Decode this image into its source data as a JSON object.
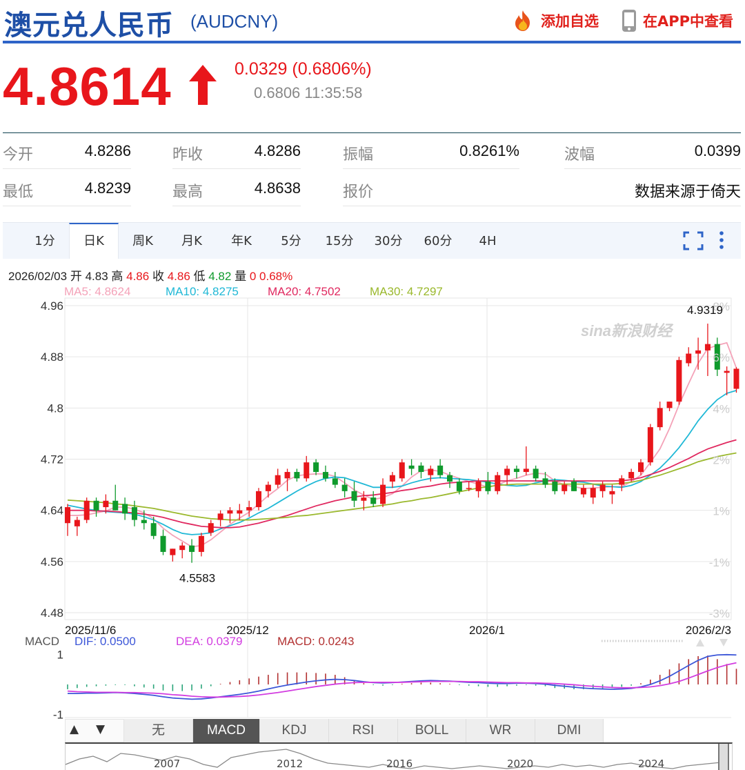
{
  "header": {
    "title": "澳元兑人民币",
    "code": "(AUDCNY)",
    "add_watch": "添加自选",
    "view_app": "在APP中查看"
  },
  "quote": {
    "price": "4.8614",
    "change": "0.0329 (0.6806%)",
    "sub": "0.6806 11:35:58"
  },
  "stats": [
    {
      "label": "今开",
      "value": "4.8286"
    },
    {
      "label": "昨收",
      "value": "4.8286"
    },
    {
      "label": "振幅",
      "value": "0.8261%"
    },
    {
      "label": "波幅",
      "value": "0.0399"
    },
    {
      "label": "最低",
      "value": "4.8239"
    },
    {
      "label": "最高",
      "value": "4.8638"
    },
    {
      "label": "报价",
      "value": "数据来源于倚天"
    }
  ],
  "tabs": [
    "1分",
    "日K",
    "周K",
    "月K",
    "年K",
    "5分",
    "15分",
    "30分",
    "60分",
    "4H"
  ],
  "active_tab": "日K",
  "ohlc": {
    "date": "2026/02/03",
    "open_label": "开",
    "open": "4.83",
    "high_label": "高",
    "high": "4.86",
    "close_label": "收",
    "close": "4.86",
    "low_label": "低",
    "low": "4.82",
    "vol_label": "量",
    "vol": "0",
    "pct": "0.68%"
  },
  "ma": {
    "ma5": "MA5: 4.8624",
    "ma10": "MA10: 4.8275",
    "ma20": "MA20: 4.7502",
    "ma30": "MA30: 4.7297"
  },
  "watermark": "sina新浪财经",
  "colors": {
    "up": "#e8161b",
    "down": "#0f9a2c",
    "accent": "#2e64c8",
    "ma5": "#f4a2b8",
    "ma10": "#1fb8d6",
    "ma20": "#e0285f",
    "ma30": "#9ab82c"
  },
  "chart_data": {
    "type": "candlestick",
    "title": "",
    "ylim": [
      4.48,
      4.96
    ],
    "yticks": [
      "4.96",
      "4.88",
      "4.8",
      "4.72",
      "4.64",
      "4.56",
      "4.48"
    ],
    "pct_ticks": [
      "8%",
      "6%",
      "4%",
      "2%",
      "1%",
      "-1%",
      "-3%"
    ],
    "x_labels": [
      "2025/11/6",
      "2025/12",
      "2026/1",
      "2026/2/3"
    ],
    "max_label": "4.9319",
    "min_label": "4.5583",
    "candles": [
      {
        "o": 4.62,
        "h": 4.65,
        "l": 4.6,
        "c": 4.645
      },
      {
        "o": 4.615,
        "h": 4.63,
        "l": 4.6,
        "c": 4.625
      },
      {
        "o": 4.625,
        "h": 4.66,
        "l": 4.62,
        "c": 4.655
      },
      {
        "o": 4.655,
        "h": 4.66,
        "l": 4.63,
        "c": 4.64
      },
      {
        "o": 4.645,
        "h": 4.665,
        "l": 4.635,
        "c": 4.655
      },
      {
        "o": 4.655,
        "h": 4.68,
        "l": 4.64,
        "c": 4.64
      },
      {
        "o": 4.65,
        "h": 4.66,
        "l": 4.625,
        "c": 4.635
      },
      {
        "o": 4.645,
        "h": 4.655,
        "l": 4.615,
        "c": 4.625
      },
      {
        "o": 4.625,
        "h": 4.64,
        "l": 4.61,
        "c": 4.62
      },
      {
        "o": 4.62,
        "h": 4.63,
        "l": 4.595,
        "c": 4.6
      },
      {
        "o": 4.6,
        "h": 4.61,
        "l": 4.57,
        "c": 4.575
      },
      {
        "o": 4.57,
        "h": 4.58,
        "l": 4.56,
        "c": 4.58
      },
      {
        "o": 4.578,
        "h": 4.59,
        "l": 4.565,
        "c": 4.585
      },
      {
        "o": 4.585,
        "h": 4.595,
        "l": 4.558,
        "c": 4.575
      },
      {
        "o": 4.575,
        "h": 4.605,
        "l": 4.568,
        "c": 4.6
      },
      {
        "o": 4.605,
        "h": 4.625,
        "l": 4.6,
        "c": 4.62
      },
      {
        "o": 4.625,
        "h": 4.64,
        "l": 4.615,
        "c": 4.635
      },
      {
        "o": 4.635,
        "h": 4.645,
        "l": 4.62,
        "c": 4.64
      },
      {
        "o": 4.635,
        "h": 4.65,
        "l": 4.625,
        "c": 4.64
      },
      {
        "o": 4.64,
        "h": 4.655,
        "l": 4.63,
        "c": 4.645
      },
      {
        "o": 4.645,
        "h": 4.675,
        "l": 4.64,
        "c": 4.67
      },
      {
        "o": 4.67,
        "h": 4.685,
        "l": 4.66,
        "c": 4.68
      },
      {
        "o": 4.68,
        "h": 4.705,
        "l": 4.675,
        "c": 4.695
      },
      {
        "o": 4.69,
        "h": 4.705,
        "l": 4.67,
        "c": 4.7
      },
      {
        "o": 4.7,
        "h": 4.705,
        "l": 4.685,
        "c": 4.69
      },
      {
        "o": 4.69,
        "h": 4.725,
        "l": 4.685,
        "c": 4.715
      },
      {
        "o": 4.715,
        "h": 4.72,
        "l": 4.695,
        "c": 4.7
      },
      {
        "o": 4.7,
        "h": 4.71,
        "l": 4.685,
        "c": 4.69
      },
      {
        "o": 4.69,
        "h": 4.7,
        "l": 4.675,
        "c": 4.68
      },
      {
        "o": 4.68,
        "h": 4.69,
        "l": 4.66,
        "c": 4.67
      },
      {
        "o": 4.67,
        "h": 4.685,
        "l": 4.645,
        "c": 4.655
      },
      {
        "o": 4.655,
        "h": 4.67,
        "l": 4.64,
        "c": 4.66
      },
      {
        "o": 4.66,
        "h": 4.67,
        "l": 4.645,
        "c": 4.65
      },
      {
        "o": 4.65,
        "h": 4.69,
        "l": 4.645,
        "c": 4.68
      },
      {
        "o": 4.685,
        "h": 4.7,
        "l": 4.675,
        "c": 4.695
      },
      {
        "o": 4.69,
        "h": 4.72,
        "l": 4.685,
        "c": 4.715
      },
      {
        "o": 4.71,
        "h": 4.72,
        "l": 4.695,
        "c": 4.705
      },
      {
        "o": 4.71,
        "h": 4.715,
        "l": 4.69,
        "c": 4.7
      },
      {
        "o": 4.695,
        "h": 4.71,
        "l": 4.685,
        "c": 4.705
      },
      {
        "o": 4.71,
        "h": 4.72,
        "l": 4.69,
        "c": 4.695
      },
      {
        "o": 4.695,
        "h": 4.7,
        "l": 4.675,
        "c": 4.685
      },
      {
        "o": 4.685,
        "h": 4.69,
        "l": 4.665,
        "c": 4.67
      },
      {
        "o": 4.675,
        "h": 4.685,
        "l": 4.67,
        "c": 4.675
      },
      {
        "o": 4.67,
        "h": 4.69,
        "l": 4.66,
        "c": 4.685
      },
      {
        "o": 4.685,
        "h": 4.7,
        "l": 4.665,
        "c": 4.67
      },
      {
        "o": 4.67,
        "h": 4.7,
        "l": 4.665,
        "c": 4.695
      },
      {
        "o": 4.695,
        "h": 4.71,
        "l": 4.68,
        "c": 4.705
      },
      {
        "o": 4.705,
        "h": 4.71,
        "l": 4.69,
        "c": 4.7
      },
      {
        "o": 4.7,
        "h": 4.74,
        "l": 4.695,
        "c": 4.705
      },
      {
        "o": 4.705,
        "h": 4.71,
        "l": 4.685,
        "c": 4.69
      },
      {
        "o": 4.69,
        "h": 4.7,
        "l": 4.675,
        "c": 4.68
      },
      {
        "o": 4.685,
        "h": 4.69,
        "l": 4.665,
        "c": 4.67
      },
      {
        "o": 4.67,
        "h": 4.685,
        "l": 4.665,
        "c": 4.68
      },
      {
        "o": 4.685,
        "h": 4.69,
        "l": 4.67,
        "c": 4.67
      },
      {
        "o": 4.665,
        "h": 4.68,
        "l": 4.66,
        "c": 4.675
      },
      {
        "o": 4.66,
        "h": 4.68,
        "l": 4.65,
        "c": 4.675
      },
      {
        "o": 4.67,
        "h": 4.685,
        "l": 4.66,
        "c": 4.68
      },
      {
        "o": 4.665,
        "h": 4.68,
        "l": 4.65,
        "c": 4.67
      },
      {
        "o": 4.68,
        "h": 4.695,
        "l": 4.67,
        "c": 4.69
      },
      {
        "o": 4.69,
        "h": 4.705,
        "l": 4.685,
        "c": 4.7
      },
      {
        "o": 4.7,
        "h": 4.72,
        "l": 4.695,
        "c": 4.715
      },
      {
        "o": 4.715,
        "h": 4.775,
        "l": 4.71,
        "c": 4.77
      },
      {
        "o": 4.77,
        "h": 4.81,
        "l": 4.765,
        "c": 4.8
      },
      {
        "o": 4.8,
        "h": 4.81,
        "l": 4.795,
        "c": 4.81
      },
      {
        "o": 4.81,
        "h": 4.88,
        "l": 4.805,
        "c": 4.875
      },
      {
        "o": 4.87,
        "h": 4.895,
        "l": 4.865,
        "c": 4.885
      },
      {
        "o": 4.885,
        "h": 4.91,
        "l": 4.86,
        "c": 4.89
      },
      {
        "o": 4.89,
        "h": 4.9319,
        "l": 4.85,
        "c": 4.9
      },
      {
        "o": 4.9,
        "h": 4.91,
        "l": 4.85,
        "c": 4.86
      },
      {
        "o": 4.855,
        "h": 4.865,
        "l": 4.82,
        "c": 4.858
      },
      {
        "o": 4.83,
        "h": 4.8638,
        "l": 4.8239,
        "c": 4.8614
      }
    ],
    "ma_series": [
      {
        "name": "MA5",
        "values": [
          4.632,
          4.632,
          4.633,
          4.636,
          4.639,
          4.645,
          4.645,
          4.642,
          4.636,
          4.627,
          4.612,
          4.601,
          4.592,
          4.583,
          4.585,
          4.594,
          4.606,
          4.618,
          4.628,
          4.637,
          4.65,
          4.663,
          4.674,
          4.687,
          4.694,
          4.696,
          4.697,
          4.697,
          4.693,
          4.683,
          4.672,
          4.664,
          4.657,
          4.66,
          4.666,
          4.678,
          4.692,
          4.702,
          4.703,
          4.701,
          4.695,
          4.69,
          4.685,
          4.681,
          4.676,
          4.68,
          4.686,
          4.69,
          4.695,
          4.698,
          4.697,
          4.686,
          4.68,
          4.677,
          4.674,
          4.675,
          4.676,
          4.677,
          4.677,
          4.685,
          4.695,
          4.715,
          4.736,
          4.768,
          4.805,
          4.838,
          4.87,
          4.893,
          4.898,
          4.902,
          4.8624
        ]
      },
      {
        "name": "MA10",
        "values": [
          4.648,
          4.645,
          4.642,
          4.64,
          4.638,
          4.637,
          4.636,
          4.634,
          4.63,
          4.625,
          4.618,
          4.61,
          4.604,
          4.602,
          4.603,
          4.605,
          4.611,
          4.616,
          4.621,
          4.628,
          4.636,
          4.643,
          4.652,
          4.661,
          4.67,
          4.678,
          4.685,
          4.69,
          4.692,
          4.691,
          4.686,
          4.681,
          4.676,
          4.676,
          4.676,
          4.678,
          4.683,
          4.687,
          4.69,
          4.691,
          4.69,
          4.689,
          4.688,
          4.686,
          4.684,
          4.681,
          4.679,
          4.678,
          4.679,
          4.683,
          4.686,
          4.688,
          4.687,
          4.685,
          4.684,
          4.681,
          4.678,
          4.677,
          4.676,
          4.679,
          4.685,
          4.695,
          4.706,
          4.721,
          4.738,
          4.758,
          4.78,
          4.798,
          4.813,
          4.823,
          4.8275
        ]
      },
      {
        "name": "MA20",
        "values": [
          4.64,
          4.64,
          4.64,
          4.639,
          4.639,
          4.638,
          4.637,
          4.636,
          4.634,
          4.632,
          4.629,
          4.625,
          4.621,
          4.618,
          4.615,
          4.614,
          4.613,
          4.613,
          4.614,
          4.617,
          4.62,
          4.624,
          4.628,
          4.632,
          4.637,
          4.642,
          4.647,
          4.651,
          4.655,
          4.658,
          4.661,
          4.663,
          4.664,
          4.666,
          4.668,
          4.671,
          4.673,
          4.676,
          4.678,
          4.681,
          4.683,
          4.684,
          4.685,
          4.686,
          4.686,
          4.686,
          4.686,
          4.686,
          4.686,
          4.686,
          4.686,
          4.686,
          4.686,
          4.686,
          4.686,
          4.686,
          4.686,
          4.686,
          4.686,
          4.688,
          4.691,
          4.696,
          4.701,
          4.707,
          4.714,
          4.721,
          4.729,
          4.736,
          4.741,
          4.746,
          4.7502
        ]
      },
      {
        "name": "MA30",
        "values": [
          4.656,
          4.655,
          4.654,
          4.653,
          4.652,
          4.65,
          4.649,
          4.647,
          4.645,
          4.643,
          4.64,
          4.637,
          4.634,
          4.631,
          4.629,
          4.627,
          4.626,
          4.625,
          4.625,
          4.625,
          4.626,
          4.627,
          4.628,
          4.629,
          4.631,
          4.632,
          4.634,
          4.636,
          4.638,
          4.64,
          4.642,
          4.644,
          4.646,
          4.648,
          4.65,
          4.653,
          4.655,
          4.658,
          4.66,
          4.663,
          4.666,
          4.669,
          4.672,
          4.675,
          4.677,
          4.679,
          4.68,
          4.681,
          4.681,
          4.681,
          4.681,
          4.681,
          4.681,
          4.681,
          4.681,
          4.681,
          4.681,
          4.681,
          4.682,
          4.684,
          4.687,
          4.691,
          4.695,
          4.7,
          4.705,
          4.71,
          4.716,
          4.72,
          4.724,
          4.727,
          4.7297
        ]
      }
    ],
    "macd": {
      "label": "MACD",
      "dif": "DIF: 0.0500",
      "dea": "DEA: 0.0379",
      "macd": "MACD: 0.0243",
      "yticks": [
        "1",
        "-1"
      ],
      "ylim": [
        -1.1,
        1.1
      ],
      "dif_values": [
        -0.3,
        -0.3,
        -0.29,
        -0.29,
        -0.28,
        -0.27,
        -0.28,
        -0.3,
        -0.33,
        -0.36,
        -0.41,
        -0.45,
        -0.47,
        -0.49,
        -0.48,
        -0.45,
        -0.41,
        -0.37,
        -0.33,
        -0.28,
        -0.22,
        -0.15,
        -0.08,
        -0.02,
        0.03,
        0.08,
        0.12,
        0.15,
        0.17,
        0.16,
        0.13,
        0.09,
        0.06,
        0.05,
        0.06,
        0.08,
        0.1,
        0.12,
        0.13,
        0.12,
        0.11,
        0.09,
        0.07,
        0.06,
        0.04,
        0.03,
        0.03,
        0.04,
        0.04,
        0.03,
        0.01,
        -0.03,
        -0.06,
        -0.09,
        -0.12,
        -0.14,
        -0.15,
        -0.16,
        -0.15,
        -0.13,
        -0.08,
        0.0,
        0.12,
        0.27,
        0.45,
        0.63,
        0.8,
        0.93,
        0.98,
        0.99,
        0.98
      ],
      "dea_values": [
        -0.22,
        -0.24,
        -0.25,
        -0.26,
        -0.26,
        -0.26,
        -0.27,
        -0.27,
        -0.28,
        -0.29,
        -0.31,
        -0.34,
        -0.36,
        -0.39,
        -0.41,
        -0.42,
        -0.42,
        -0.41,
        -0.4,
        -0.38,
        -0.35,
        -0.31,
        -0.27,
        -0.22,
        -0.17,
        -0.12,
        -0.07,
        -0.03,
        0.01,
        0.04,
        0.06,
        0.07,
        0.07,
        0.07,
        0.07,
        0.07,
        0.08,
        0.09,
        0.1,
        0.1,
        0.1,
        0.1,
        0.09,
        0.09,
        0.08,
        0.07,
        0.06,
        0.06,
        0.05,
        0.05,
        0.04,
        0.03,
        0.01,
        -0.01,
        -0.04,
        -0.06,
        -0.08,
        -0.1,
        -0.11,
        -0.11,
        -0.1,
        -0.08,
        -0.04,
        0.02,
        0.1,
        0.21,
        0.33,
        0.45,
        0.56,
        0.65,
        0.72
      ]
    },
    "indicator_tabs": [
      "无",
      "MACD",
      "KDJ",
      "RSI",
      "BOLL",
      "WR",
      "DMI"
    ],
    "active_indicator": "MACD",
    "nav_years": [
      "2007",
      "2012",
      "2016",
      "2020",
      "2024"
    ]
  }
}
